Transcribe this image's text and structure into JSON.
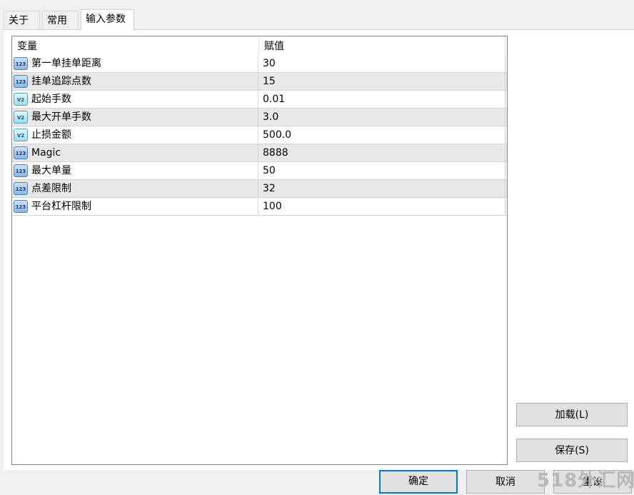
{
  "tabs": [
    {
      "label": "关于"
    },
    {
      "label": "常用"
    },
    {
      "label": "输入参数"
    }
  ],
  "grid": {
    "columns": [
      "变量",
      "赋值"
    ],
    "rows": [
      {
        "type": "int",
        "icon_text": "123",
        "name": "第一单挂单距离",
        "value": "30"
      },
      {
        "type": "int",
        "icon_text": "123",
        "name": "挂单追踪点数",
        "value": "15"
      },
      {
        "type": "double",
        "icon_text": "V2",
        "name": "起始手数",
        "value": "0.01"
      },
      {
        "type": "double",
        "icon_text": "V2",
        "name": "最大开单手数",
        "value": "3.0"
      },
      {
        "type": "double",
        "icon_text": "V2",
        "name": "止损金额",
        "value": "500.0"
      },
      {
        "type": "int",
        "icon_text": "123",
        "name": "Magic",
        "value": "8888"
      },
      {
        "type": "int",
        "icon_text": "123",
        "name": "最大单量",
        "value": "50"
      },
      {
        "type": "int",
        "icon_text": "123",
        "name": "点差限制",
        "value": "32"
      },
      {
        "type": "int",
        "icon_text": "123",
        "name": "平台杠杆限制",
        "value": "100"
      }
    ]
  },
  "buttons": {
    "load": "加载(L)",
    "save": "保存(S)",
    "ok": "确定",
    "cancel": "取消",
    "reset": "重设"
  },
  "watermark": "518外汇网",
  "colors": {
    "accent": "#0078d7",
    "alt_row": "#e8e8e8"
  }
}
